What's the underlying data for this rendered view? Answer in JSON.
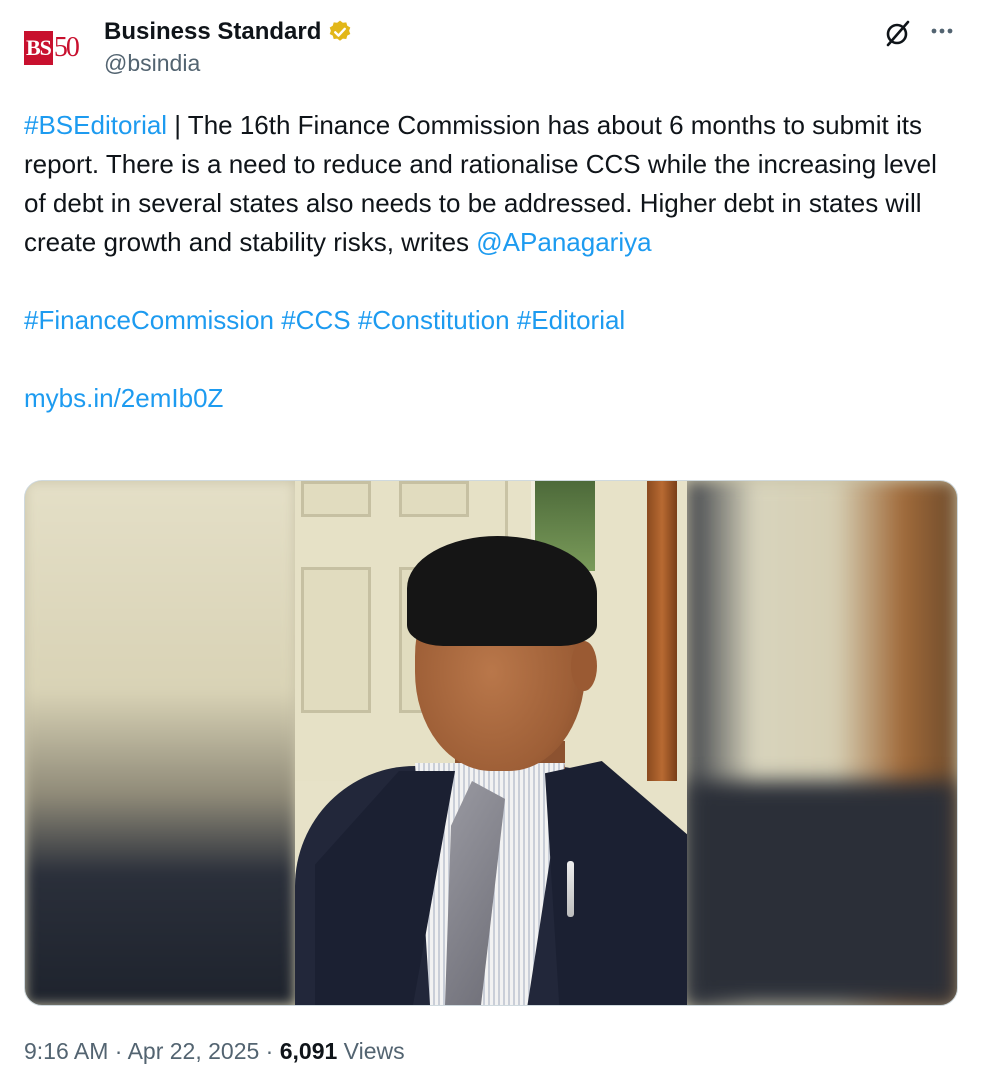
{
  "account": {
    "avatar_text_left": "BS",
    "avatar_text_right": "50",
    "display_name": "Business Standard",
    "handle": "@bsindia",
    "brand_color": "#c8102e"
  },
  "tweet": {
    "hashtag_lead": "#BSEditorial",
    "body": " | The 16th Finance Commission has about 6 months to submit its report. There is a need to reduce and rationalise CCS while the increasing level of debt in several states also needs to be addressed. Higher debt in states will create growth and stability risks, writes ",
    "mention": "@APanagariya",
    "hashtags": [
      "#FinanceCommission",
      "#CCS",
      "#Constitution",
      "#Editorial"
    ],
    "link": "mybs.in/2emIb0Z",
    "link_color": "#1d9bf0"
  },
  "icons": {
    "verified": "verified-badge-icon",
    "grok": "grok-icon",
    "more": "more-icon"
  },
  "meta": {
    "time": "9:16 AM",
    "separator": " · ",
    "date": "Apr 22, 2025",
    "views_count": "6,091",
    "views_label": " Views"
  }
}
